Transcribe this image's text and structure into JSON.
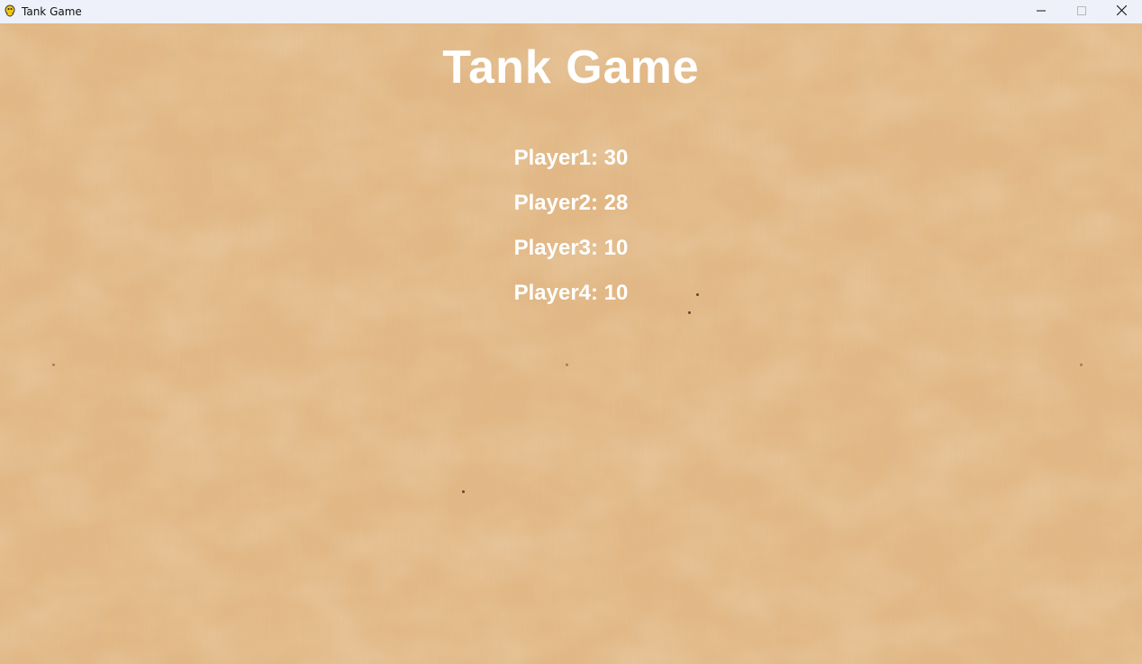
{
  "window": {
    "title": "Tank Game",
    "app_icon": "pygame-snake-icon",
    "controls": {
      "minimize_icon": "minimize-icon",
      "maximize_icon": "maximize-icon",
      "close_icon": "close-icon"
    }
  },
  "game": {
    "title": "Tank Game",
    "scores": [
      {
        "text": "Player1: 30"
      },
      {
        "text": "Player2: 28"
      },
      {
        "text": "Player3: 10"
      },
      {
        "text": "Player4: 10"
      }
    ],
    "background_color": "#e2b784",
    "text_color": "#ffffff"
  }
}
